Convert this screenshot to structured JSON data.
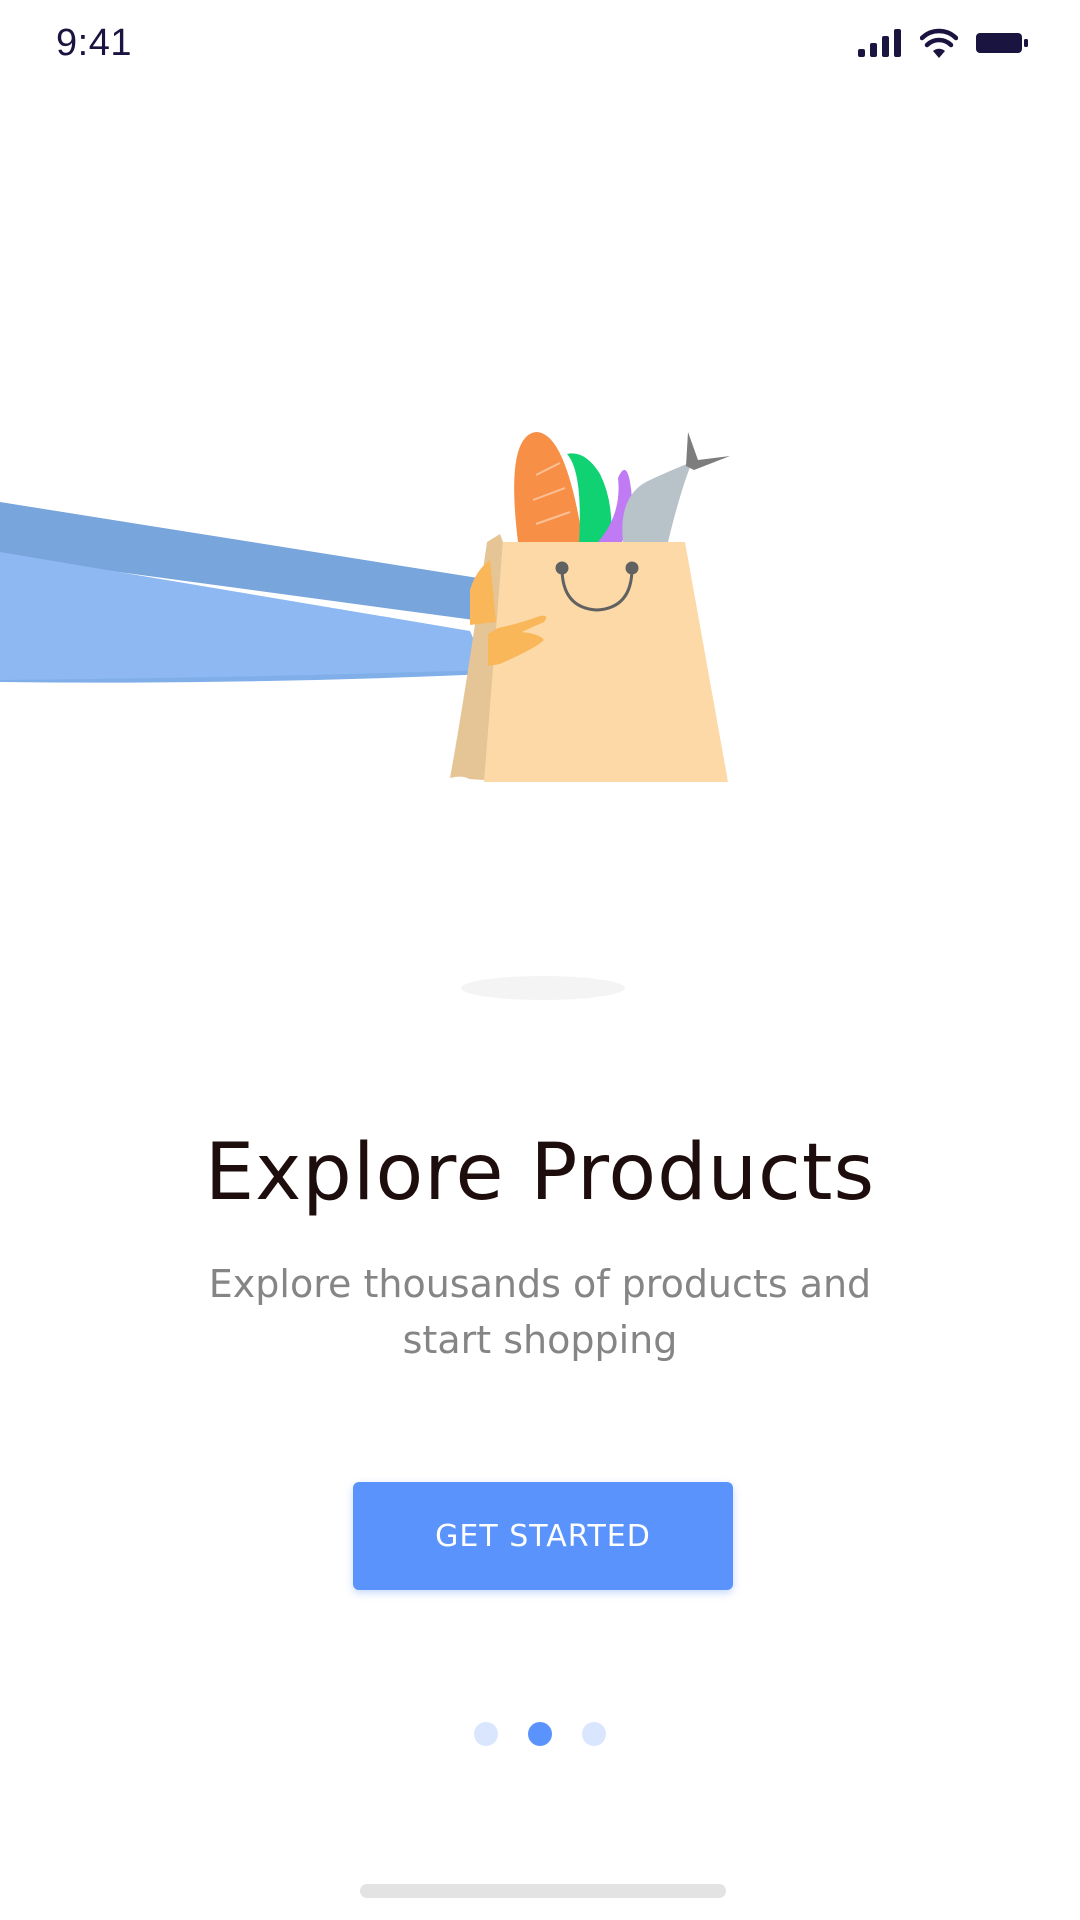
{
  "status_bar": {
    "time": "9:41",
    "icons": [
      "signal-icon",
      "wifi-icon",
      "battery-icon"
    ]
  },
  "onboarding": {
    "title": "Explore Products",
    "subtitle": "Explore thousands of products and start shopping",
    "cta_label": "GET STARTED",
    "page_count": 3,
    "active_page": 2
  },
  "colors": {
    "accent": "#5b93fc",
    "dot_inactive": "#d9e6fe",
    "title": "#1e0d0d",
    "subtitle": "#858585"
  }
}
